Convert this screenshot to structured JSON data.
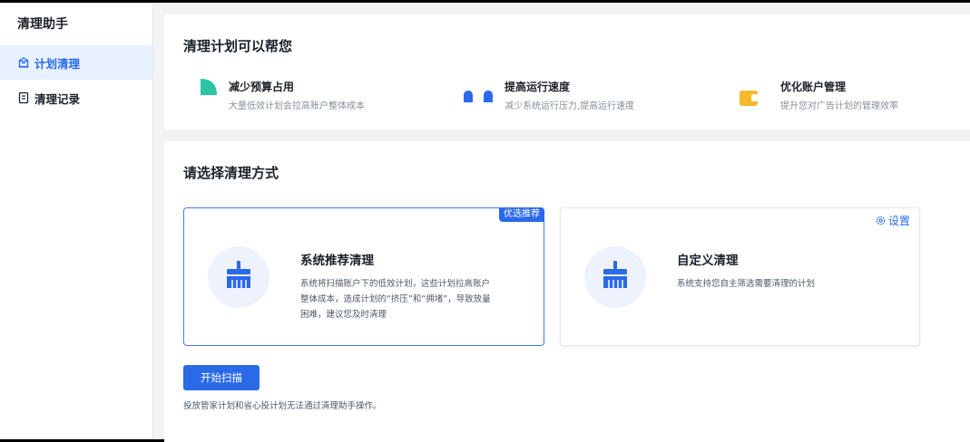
{
  "sidebar": {
    "title": "清理助手",
    "items": [
      {
        "label": "计划清理",
        "icon": "building-icon",
        "active": true
      },
      {
        "label": "清理记录",
        "icon": "document-icon",
        "active": false
      }
    ]
  },
  "benefits": {
    "title": "清理计划可以帮您",
    "items": [
      {
        "title": "减少预算占用",
        "desc": "大量低效计划会拉高账户整体成本",
        "icon": "quarter-pie-icon",
        "color": "#2bc4a5"
      },
      {
        "title": "提高运行速度",
        "desc": "减少系统运行压力,提高运行速度",
        "icon": "speed-icon",
        "color": "#2a6ae9"
      },
      {
        "title": "优化账户管理",
        "desc": "提升您对广告计划的管理效率",
        "icon": "wallet-icon",
        "color": "#f5b92c"
      }
    ]
  },
  "methods": {
    "title": "请选择清理方式",
    "options": [
      {
        "title": "系统推荐清理",
        "badge": "优选推荐",
        "desc": "系统将扫描账户下的低效计划，这些计划拉高账户整体成本，造成计划的“挤压”和“拥堵”，导致放量困难，建议您及时清理",
        "icon": "broom-icon",
        "selected": true
      },
      {
        "title": "自定义清理",
        "settings_label": "设置",
        "desc": "系统支持您自主筛选需要清理的计划",
        "icon": "broom-icon",
        "selected": false
      }
    ],
    "start_button": "开始扫描",
    "note": "投放管家计划和省心投计划无法通过清理助手操作。"
  },
  "colors": {
    "accent": "#2a6ae9",
    "green": "#2bc4a5",
    "yellow": "#f5b92c"
  }
}
